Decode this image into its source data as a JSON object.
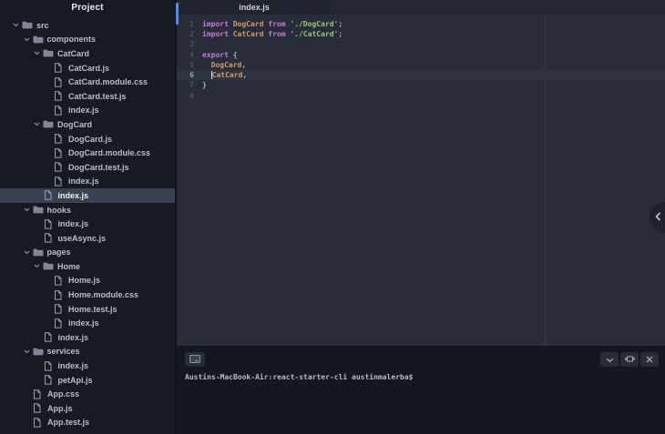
{
  "sidebar": {
    "title": "Project",
    "tree": [
      {
        "label": "src",
        "type": "folder",
        "level": 1,
        "expanded": true
      },
      {
        "label": "components",
        "type": "folder",
        "level": 2,
        "expanded": true
      },
      {
        "label": "CatCard",
        "type": "folder",
        "level": 3,
        "expanded": true
      },
      {
        "label": "CatCard.js",
        "type": "file",
        "level": 4
      },
      {
        "label": "CatCard.module.css",
        "type": "file",
        "level": 4
      },
      {
        "label": "CatCard.test.js",
        "type": "file",
        "level": 4
      },
      {
        "label": "index.js",
        "type": "file",
        "level": 4
      },
      {
        "label": "DogCard",
        "type": "folder",
        "level": 3,
        "expanded": true
      },
      {
        "label": "DogCard.js",
        "type": "file",
        "level": 4
      },
      {
        "label": "DogCard.module.css",
        "type": "file",
        "level": 4
      },
      {
        "label": "DogCard.test.js",
        "type": "file",
        "level": 4
      },
      {
        "label": "index.js",
        "type": "file",
        "level": 4
      },
      {
        "label": "index.js",
        "type": "file",
        "level": 3,
        "selected": true
      },
      {
        "label": "hooks",
        "type": "folder",
        "level": 2,
        "expanded": true
      },
      {
        "label": "index.js",
        "type": "file",
        "level": 3
      },
      {
        "label": "useAsync.js",
        "type": "file",
        "level": 3
      },
      {
        "label": "pages",
        "type": "folder",
        "level": 2,
        "expanded": true
      },
      {
        "label": "Home",
        "type": "folder",
        "level": 3,
        "expanded": true
      },
      {
        "label": "Home.js",
        "type": "file",
        "level": 4
      },
      {
        "label": "Home.module.css",
        "type": "file",
        "level": 4
      },
      {
        "label": "Home.test.js",
        "type": "file",
        "level": 4
      },
      {
        "label": "index.js",
        "type": "file",
        "level": 4
      },
      {
        "label": "index.js",
        "type": "file",
        "level": 3
      },
      {
        "label": "services",
        "type": "folder",
        "level": 2,
        "expanded": true
      },
      {
        "label": "index.js",
        "type": "file",
        "level": 3
      },
      {
        "label": "petApi.js",
        "type": "file",
        "level": 3
      },
      {
        "label": "App.css",
        "type": "file",
        "level": 2
      },
      {
        "label": "App.js",
        "type": "file",
        "level": 2
      },
      {
        "label": "App.test.js",
        "type": "file",
        "level": 2
      }
    ]
  },
  "editor": {
    "tab": {
      "label": "index.js"
    },
    "active_line": 6,
    "lines": [
      {
        "num": 1,
        "tokens": [
          {
            "text": "import ",
            "type": "keyword"
          },
          {
            "text": "DogCard",
            "type": "identifier"
          },
          {
            "text": " ",
            "type": "plain"
          },
          {
            "text": "from",
            "type": "keyword"
          },
          {
            "text": " ",
            "type": "plain"
          },
          {
            "text": "'./DogCard'",
            "type": "string"
          },
          {
            "text": ";",
            "type": "plain"
          }
        ]
      },
      {
        "num": 2,
        "tokens": [
          {
            "text": "import ",
            "type": "keyword"
          },
          {
            "text": "CatCard",
            "type": "identifier"
          },
          {
            "text": " ",
            "type": "plain"
          },
          {
            "text": "from",
            "type": "keyword"
          },
          {
            "text": " ",
            "type": "plain"
          },
          {
            "text": "'./CatCard'",
            "type": "string"
          },
          {
            "text": ";",
            "type": "plain"
          }
        ]
      },
      {
        "num": 3,
        "tokens": []
      },
      {
        "num": 4,
        "tokens": [
          {
            "text": "export",
            "type": "keyword"
          },
          {
            "text": " {",
            "type": "plain"
          }
        ]
      },
      {
        "num": 5,
        "tokens": [
          {
            "text": "  ",
            "type": "plain"
          },
          {
            "text": "DogCard",
            "type": "identifier"
          },
          {
            "text": ",",
            "type": "plain"
          }
        ]
      },
      {
        "num": 6,
        "tokens": [
          {
            "text": "  ",
            "type": "plain"
          },
          {
            "text": "",
            "type": "cursor"
          },
          {
            "text": "CatCard",
            "type": "identifier"
          },
          {
            "text": ",",
            "type": "plain"
          }
        ]
      },
      {
        "num": 7,
        "tokens": [
          {
            "text": "}",
            "type": "plain"
          }
        ]
      },
      {
        "num": 8,
        "tokens": []
      }
    ],
    "colors": {
      "keyword": "#c678dd",
      "identifier": "#d19a66",
      "string": "#98c379",
      "plain": "#abb2bf",
      "accent_blue": "#4a8df8",
      "editor_bg": "#282d39",
      "active_line_bg": "#2e3442"
    }
  },
  "terminal": {
    "prompt": "Austins-MacBook-Air:react-starter-cli austinmalerba$",
    "left_button": {
      "icon": "terminal-icon"
    },
    "buttons": [
      {
        "name": "collapse",
        "icon": "chevron-down-icon"
      },
      {
        "name": "expand",
        "icon": "expand-icon"
      },
      {
        "name": "close",
        "icon": "close-icon"
      }
    ]
  },
  "side_panel_toggle": {
    "icon": "chevron-left-icon"
  }
}
